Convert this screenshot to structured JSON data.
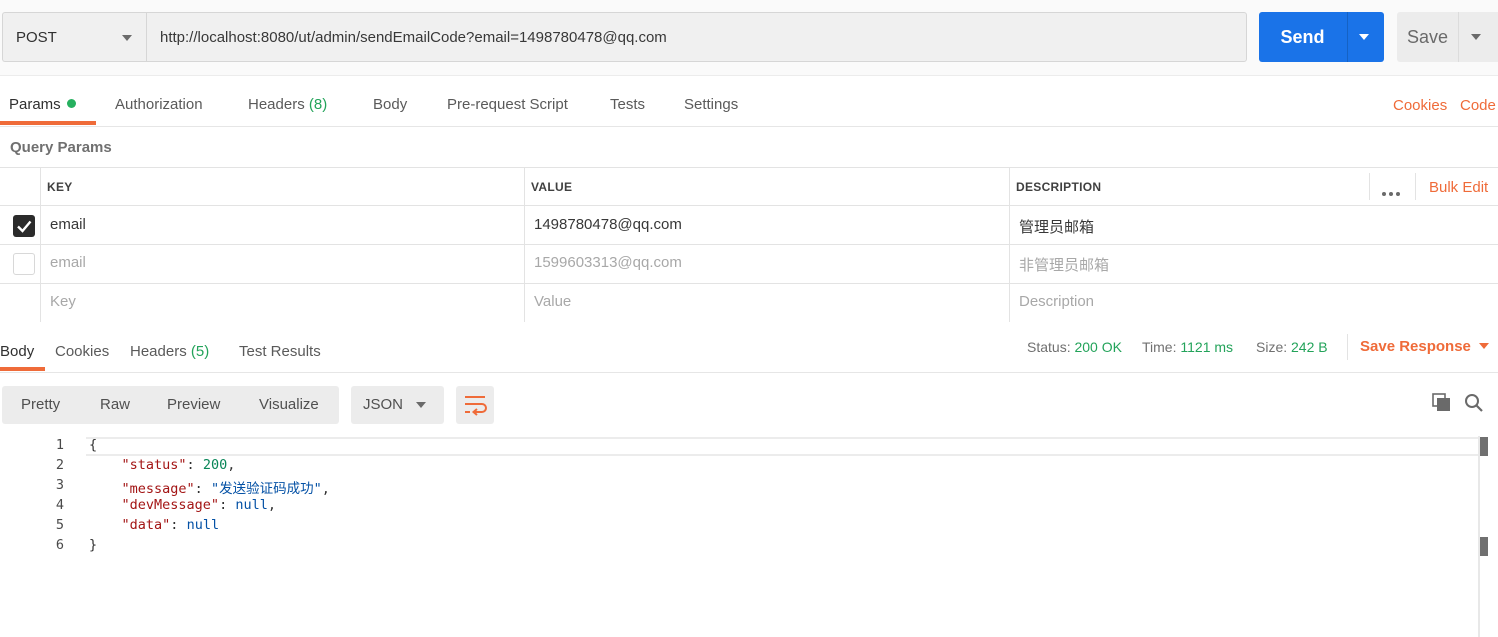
{
  "request": {
    "method": "POST",
    "url": "http://localhost:8080/ut/admin/sendEmailCode?email=1498780478@qq.com",
    "send_label": "Send",
    "save_label": "Save"
  },
  "request_tabs": [
    {
      "label": "Params",
      "active": true
    },
    {
      "label": "Authorization"
    },
    {
      "label": "Headers",
      "count": "(8)"
    },
    {
      "label": "Body"
    },
    {
      "label": "Pre-request Script"
    },
    {
      "label": "Tests"
    },
    {
      "label": "Settings"
    }
  ],
  "request_links": {
    "cookies": "Cookies",
    "code": "Code"
  },
  "query_params": {
    "title": "Query Params",
    "headers": {
      "key": "KEY",
      "value": "VALUE",
      "description": "DESCRIPTION",
      "bulk_edit": "Bulk Edit"
    },
    "rows": [
      {
        "checked": true,
        "key": "email",
        "value": "1498780478@qq.com",
        "description": "管理员邮箱"
      },
      {
        "checked": false,
        "key": "email",
        "value": "1599603313@qq.com",
        "description": "非管理员邮箱"
      }
    ],
    "placeholder": {
      "key": "Key",
      "value": "Value",
      "description": "Description"
    }
  },
  "response_tabs": [
    {
      "label": "Body",
      "active": true
    },
    {
      "label": "Cookies"
    },
    {
      "label": "Headers",
      "count": "(5)"
    },
    {
      "label": "Test Results"
    }
  ],
  "response_meta": {
    "status_label": "Status:",
    "status": "200 OK",
    "time_label": "Time:",
    "time": "1121 ms",
    "size_label": "Size:",
    "size": "242 B",
    "save_response": "Save Response"
  },
  "view_modes": [
    "Pretty",
    "Raw",
    "Preview",
    "Visualize"
  ],
  "format": "JSON",
  "response_body": {
    "line_numbers": [
      "1",
      "2",
      "3",
      "4",
      "5",
      "6"
    ],
    "open_brace": "{",
    "close_brace": "}",
    "fields": [
      {
        "key": "\"status\"",
        "value": "200",
        "type": "number",
        "comma": ","
      },
      {
        "key": "\"message\"",
        "value": "\"发送验证码成功\"",
        "type": "string",
        "comma": ","
      },
      {
        "key": "\"devMessage\"",
        "value": "null",
        "type": "null",
        "comma": ","
      },
      {
        "key": "\"data\"",
        "value": "null",
        "type": "null",
        "comma": ""
      }
    ]
  },
  "colors": {
    "accent_orange": "#ef6b39",
    "send_blue": "#1a73e8",
    "success_green": "#23a35a"
  }
}
